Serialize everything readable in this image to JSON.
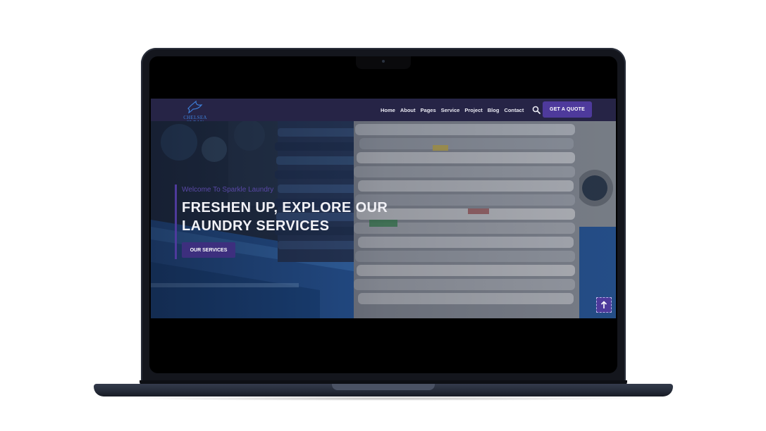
{
  "site": {
    "logo_text": "CHELSEA CLEAN",
    "nav": {
      "links": [
        "Home",
        "About",
        "Pages",
        "Service",
        "Project",
        "Blog",
        "Contact"
      ],
      "quote_button": "GET A QUOTE"
    },
    "hero": {
      "welcome": "Welcome To Sparkle Laundry",
      "title_line1": "FRESHEN UP, EXPLORE OUR",
      "title_line2": "LAUNDRY SERVICES",
      "cta_button": "OUR SERVICES"
    }
  },
  "colors": {
    "navbar_bg": "#262446",
    "accent_purple": "#4e3a9c",
    "laptop_body": "#14161d"
  },
  "icons": {
    "search": "search-icon",
    "scroll_top": "arrow-up-icon",
    "logo": "dove-icon"
  }
}
